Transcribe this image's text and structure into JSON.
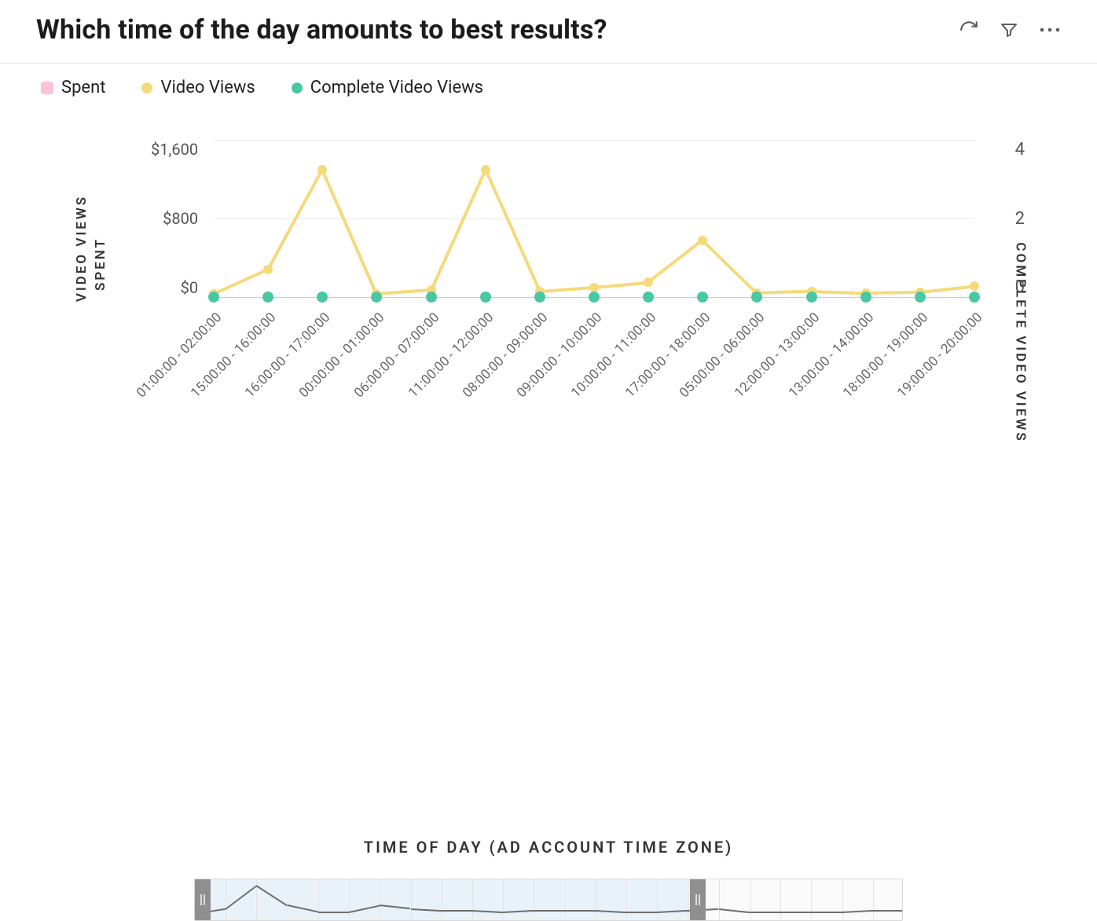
{
  "title": "Which time of the day amounts to best results?",
  "legend": {
    "spent": "Spent",
    "videoViews": "Video Views",
    "completeViews": "Complete Video Views"
  },
  "axes": {
    "left1_label": "VIDEO VIEWS",
    "left2_label": "SPENT",
    "right_label": "COMPLETE VIDEO VIEWS",
    "xlabel": "TIME OF DAY (AD ACCOUNT TIME ZONE)",
    "yLeft": {
      "t0": "$1,600",
      "t1": "$800",
      "t2": "$0"
    },
    "yRight": {
      "t0": "4",
      "t1": "2",
      "t2": "0"
    }
  },
  "chart_data": {
    "type": "line",
    "title": "Which time of the day amounts to best results?",
    "xlabel": "TIME OF DAY (AD ACCOUNT TIME ZONE)",
    "categories": [
      "01:00:00 - 02:00:00",
      "15:00:00 - 16:00:00",
      "16:00:00 - 17:00:00",
      "00:00:00 - 01:00:00",
      "06:00:00 - 07:00:00",
      "11:00:00 - 12:00:00",
      "08:00:00 - 09:00:00",
      "09:00:00 - 10:00:00",
      "10:00:00 - 11:00:00",
      "17:00:00 - 18:00:00",
      "05:00:00 - 06:00:00",
      "12:00:00 - 13:00:00",
      "13:00:00 - 14:00:00",
      "18:00:00 - 19:00:00",
      "19:00:00 - 20:00:00"
    ],
    "axes": {
      "left_primary": {
        "label": "VIDEO VIEWS"
      },
      "left_secondary": {
        "label": "SPENT",
        "ticks": [
          0,
          800,
          1600
        ],
        "unit": "$"
      },
      "right": {
        "label": "COMPLETE VIDEO VIEWS",
        "ticks": [
          0,
          2,
          4
        ]
      }
    },
    "series": [
      {
        "name": "Spent",
        "axis": "left_secondary",
        "color": "#ffc0d8",
        "values": [
          0,
          0,
          0,
          0,
          0,
          0,
          0,
          0,
          0,
          0,
          0,
          0,
          0,
          0,
          0
        ]
      },
      {
        "name": "Video Views",
        "axis": "left_primary",
        "color": "#f5d97a",
        "values": [
          30,
          280,
          1300,
          30,
          70,
          1300,
          60,
          100,
          150,
          580,
          40,
          60,
          40,
          50,
          110
        ]
      },
      {
        "name": "Complete Video Views",
        "axis": "right",
        "color": "#49c7a3",
        "values": [
          0,
          0,
          0,
          0,
          0,
          0,
          0,
          0,
          0,
          0,
          0,
          0,
          0,
          0,
          0
        ]
      }
    ],
    "ylim_spent": [
      0,
      1600
    ],
    "ylim_right": [
      0,
      4
    ]
  },
  "range_slider": {
    "selection_fraction": 0.7,
    "spark_values": [
      1,
      4,
      18,
      6,
      2,
      2,
      6,
      4,
      3,
      3,
      2,
      3,
      3,
      3,
      2,
      2,
      3,
      4,
      2,
      2,
      2,
      2,
      3,
      3
    ]
  },
  "colors": {
    "spent": "#ffc0d8",
    "videoViews": "#f5d97a",
    "completeViews": "#49c7a3"
  }
}
